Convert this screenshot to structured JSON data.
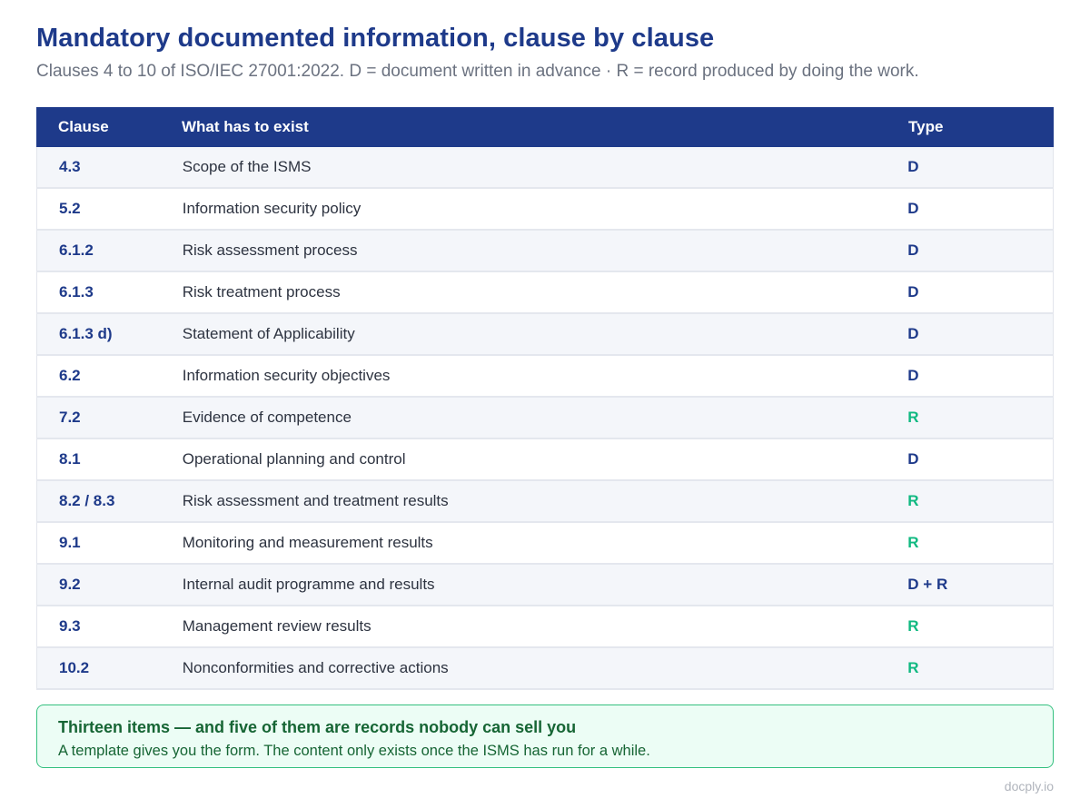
{
  "header": {
    "title": "Mandatory documented information, clause by clause",
    "subtitle": "Clauses 4 to 10 of ISO/IEC 27001:2022. D = document written in advance · R = record produced by doing the work."
  },
  "table": {
    "columns": [
      "Clause",
      "What has to exist",
      "Type"
    ],
    "rows": [
      {
        "clause": "4.3",
        "item": "Scope of the ISMS",
        "type": "D"
      },
      {
        "clause": "5.2",
        "item": "Information security policy",
        "type": "D"
      },
      {
        "clause": "6.1.2",
        "item": "Risk assessment process",
        "type": "D"
      },
      {
        "clause": "6.1.3",
        "item": "Risk treatment process",
        "type": "D"
      },
      {
        "clause": "6.1.3 d)",
        "item": "Statement of Applicability",
        "type": "D"
      },
      {
        "clause": "6.2",
        "item": "Information security objectives",
        "type": "D"
      },
      {
        "clause": "7.2",
        "item": "Evidence of competence",
        "type": "R"
      },
      {
        "clause": "8.1",
        "item": "Operational planning and control",
        "type": "D"
      },
      {
        "clause": "8.2 / 8.3",
        "item": "Risk assessment and treatment results",
        "type": "R"
      },
      {
        "clause": "9.1",
        "item": "Monitoring and measurement results",
        "type": "R"
      },
      {
        "clause": "9.2",
        "item": "Internal audit programme and results",
        "type": "D + R"
      },
      {
        "clause": "9.3",
        "item": "Management review results",
        "type": "R"
      },
      {
        "clause": "10.2",
        "item": "Nonconformities and corrective actions",
        "type": "R"
      }
    ]
  },
  "callout": {
    "title": "Thirteen items — and five of them are records nobody can sell you",
    "body": "A template gives you the form. The content only exists once the ISMS has run for a while."
  },
  "footer": {
    "brand": "docply.io"
  },
  "colors": {
    "primary": "#1e3a8a",
    "record_green": "#10b981",
    "callout_bg": "#ecfdf5",
    "callout_border": "#34c07f"
  }
}
